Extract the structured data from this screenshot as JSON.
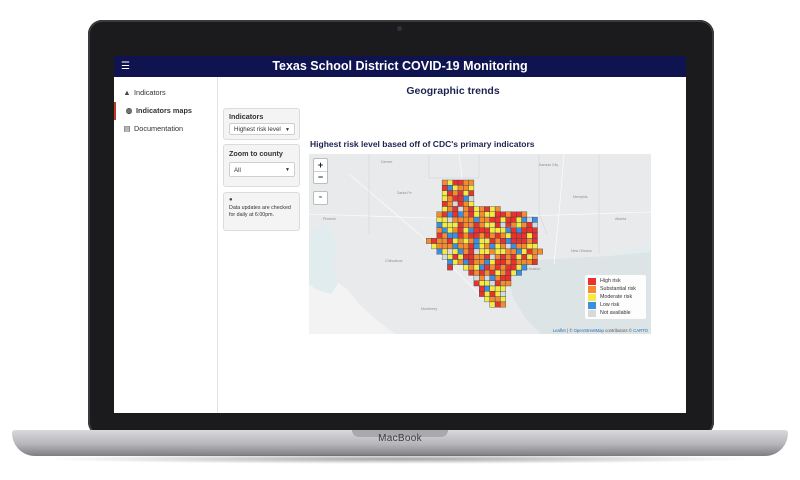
{
  "device": {
    "brand": "MacBook"
  },
  "app": {
    "title": "Texas School District COVID-19 Monitoring",
    "menu_icon": "hamburger-icon",
    "nav_color": "#0f1450"
  },
  "sidebar": {
    "items": [
      {
        "label": "Indicators",
        "icon": "warning-icon",
        "active": false
      },
      {
        "label": "Indicators maps",
        "icon": "globe-icon",
        "active": true
      },
      {
        "label": "Documentation",
        "icon": "book-icon",
        "active": false
      }
    ]
  },
  "main": {
    "section_title": "Geographic trends",
    "map_title": "Highest risk level based off of CDC's primary indicators"
  },
  "filters": {
    "indicators": {
      "label": "Indicators",
      "value": "Highest risk level"
    },
    "county": {
      "label": "Zoom to county",
      "value": "All"
    },
    "note": "Data updates are checked for daily at 6:00pm."
  },
  "map": {
    "controls": {
      "zoom_in": "+",
      "zoom_out": "−",
      "reset": "≈"
    },
    "legend": [
      {
        "label": "High risk",
        "color": "#e8322b"
      },
      {
        "label": "Substantial risk",
        "color": "#f58b2d"
      },
      {
        "label": "Moderate risk",
        "color": "#f4ea43"
      },
      {
        "label": "Low risk",
        "color": "#3a8fe0"
      },
      {
        "label": "Not available",
        "color": "#d9d9d9"
      }
    ],
    "attribution": {
      "leaflet": "Leaflet",
      "sep1": " | © ",
      "osm": "OpenStreetMap",
      "mid": " contributors © ",
      "carto": "CARTO"
    },
    "places": [
      "Denver",
      "Kansas City",
      "Santa Fe",
      "Phoenix",
      "Dallas",
      "Houston",
      "Chihuahua",
      "Monterrey",
      "Memphis",
      "Atlanta",
      "New Orleans"
    ]
  }
}
